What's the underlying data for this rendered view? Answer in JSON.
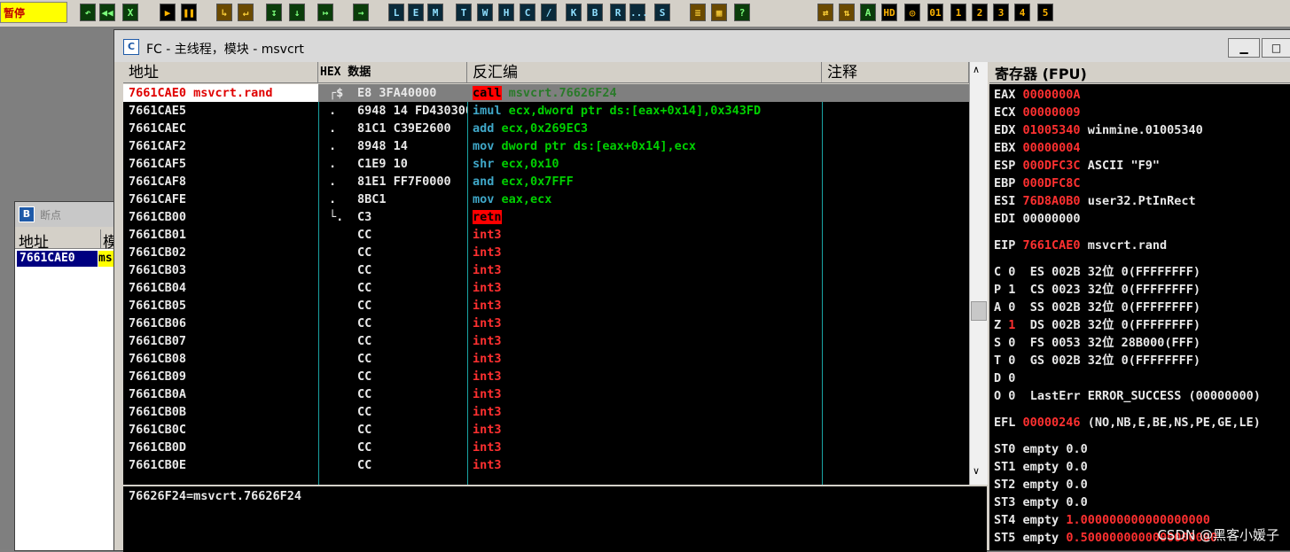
{
  "toolbar": {
    "status": "暂停",
    "buttons": [
      "↶",
      "◀◀",
      "X",
      "▶",
      "❚❚",
      "↳",
      "↵",
      "↧",
      "↓",
      "↦",
      "→",
      "L",
      "E",
      "M",
      "T",
      "W",
      "H",
      "C",
      "/",
      "K",
      "B",
      "R",
      "...",
      "S",
      "≡",
      "▦",
      "?",
      "⇄",
      "⇅",
      "A",
      "HD",
      "◎",
      "01",
      "1",
      "2",
      "3",
      "4",
      "5"
    ]
  },
  "bp_window": {
    "title": "断点",
    "header_addr": "地址",
    "header_module": "模",
    "row_addr": "7661CAE0",
    "row_module": "ms"
  },
  "cpu_window": {
    "title": "FC - 主线程，模块 - msvcrt",
    "headers": {
      "addr": "地址",
      "hex": "HEX 数据",
      "asm": "反汇编",
      "comment": "注释",
      "regs": "寄存器 (FPU)"
    },
    "rows": [
      {
        "addr": "7661CAE0 msvcrt.rand",
        "mark": "┌$",
        "hex": "E8 3FA40000",
        "op": "call",
        "args": "msvcrt.76626F24",
        "op_hl": true,
        "selected": true
      },
      {
        "addr": "7661CAE5",
        "mark": ".",
        "hex": "6948 14 FD430300",
        "op": "imul",
        "args": "ecx,dword ptr ds:[eax+0x14],0x343FD"
      },
      {
        "addr": "7661CAEC",
        "mark": ".",
        "hex": "81C1 C39E2600",
        "op": "add",
        "args": "ecx,0x269EC3"
      },
      {
        "addr": "7661CAF2",
        "mark": ".",
        "hex": "8948 14",
        "op": "mov",
        "args": "dword ptr ds:[eax+0x14],ecx"
      },
      {
        "addr": "7661CAF5",
        "mark": ".",
        "hex": "C1E9 10",
        "op": "shr",
        "args": "ecx,0x10"
      },
      {
        "addr": "7661CAF8",
        "mark": ".",
        "hex": "81E1 FF7F0000",
        "op": "and",
        "args": "ecx,0x7FFF"
      },
      {
        "addr": "7661CAFE",
        "mark": ".",
        "hex": "8BC1",
        "op": "mov",
        "args": "eax,ecx"
      },
      {
        "addr": "7661CB00",
        "mark": "└.",
        "hex": "C3",
        "op": "retn",
        "args": "",
        "op_hl": true
      },
      {
        "addr": "7661CB01",
        "mark": "",
        "hex": "CC",
        "op": "int3",
        "args": ""
      },
      {
        "addr": "7661CB02",
        "mark": "",
        "hex": "CC",
        "op": "int3",
        "args": ""
      },
      {
        "addr": "7661CB03",
        "mark": "",
        "hex": "CC",
        "op": "int3",
        "args": ""
      },
      {
        "addr": "7661CB04",
        "mark": "",
        "hex": "CC",
        "op": "int3",
        "args": ""
      },
      {
        "addr": "7661CB05",
        "mark": "",
        "hex": "CC",
        "op": "int3",
        "args": ""
      },
      {
        "addr": "7661CB06",
        "mark": "",
        "hex": "CC",
        "op": "int3",
        "args": ""
      },
      {
        "addr": "7661CB07",
        "mark": "",
        "hex": "CC",
        "op": "int3",
        "args": ""
      },
      {
        "addr": "7661CB08",
        "mark": "",
        "hex": "CC",
        "op": "int3",
        "args": ""
      },
      {
        "addr": "7661CB09",
        "mark": "",
        "hex": "CC",
        "op": "int3",
        "args": ""
      },
      {
        "addr": "7661CB0A",
        "mark": "",
        "hex": "CC",
        "op": "int3",
        "args": ""
      },
      {
        "addr": "7661CB0B",
        "mark": "",
        "hex": "CC",
        "op": "int3",
        "args": ""
      },
      {
        "addr": "7661CB0C",
        "mark": "",
        "hex": "CC",
        "op": "int3",
        "args": ""
      },
      {
        "addr": "7661CB0D",
        "mark": "",
        "hex": "CC",
        "op": "int3",
        "args": ""
      },
      {
        "addr": "7661CB0E",
        "mark": "",
        "hex": "CC",
        "op": "int3",
        "args": ""
      }
    ],
    "info_text": "76626F24=msvcrt.76626F24",
    "registers": [
      {
        "name": "EAX",
        "value": "0000000A",
        "comment": "",
        "red": true
      },
      {
        "name": "ECX",
        "value": "00000009",
        "comment": "",
        "red": true
      },
      {
        "name": "EDX",
        "value": "01005340",
        "comment": "winmine.01005340",
        "red": true
      },
      {
        "name": "EBX",
        "value": "00000004",
        "comment": "",
        "red": true
      },
      {
        "name": "ESP",
        "value": "000DFC3C",
        "comment": "ASCII \"F9\"",
        "red": true
      },
      {
        "name": "EBP",
        "value": "000DFC8C",
        "comment": "",
        "red": true
      },
      {
        "name": "ESI",
        "value": "76D8A0B0",
        "comment": "user32.PtInRect",
        "red": true
      },
      {
        "name": "EDI",
        "value": "00000000",
        "comment": "",
        "red": false
      }
    ],
    "eip": {
      "name": "EIP",
      "value": "7661CAE0",
      "comment": "msvcrt.rand"
    },
    "flags": [
      {
        "f": "C",
        "v": "0",
        "seg": "ES",
        "sv": "002B",
        "bits": "32位",
        "base": "0(FFFFFFFF)",
        "red": false
      },
      {
        "f": "P",
        "v": "1",
        "seg": "CS",
        "sv": "0023",
        "bits": "32位",
        "base": "0(FFFFFFFF)",
        "red": false
      },
      {
        "f": "A",
        "v": "0",
        "seg": "SS",
        "sv": "002B",
        "bits": "32位",
        "base": "0(FFFFFFFF)",
        "red": false
      },
      {
        "f": "Z",
        "v": "1",
        "seg": "DS",
        "sv": "002B",
        "bits": "32位",
        "base": "0(FFFFFFFF)",
        "red": true
      },
      {
        "f": "S",
        "v": "0",
        "seg": "FS",
        "sv": "0053",
        "bits": "32位",
        "base": "28B000(FFF)",
        "red": false
      },
      {
        "f": "T",
        "v": "0",
        "seg": "GS",
        "sv": "002B",
        "bits": "32位",
        "base": "0(FFFFFFFF)",
        "red": false
      },
      {
        "f": "D",
        "v": "0",
        "seg": "",
        "sv": "",
        "bits": "",
        "base": "",
        "red": false
      },
      {
        "f": "O",
        "v": "0",
        "seg": "LastErr",
        "sv": "ERROR_SUCCESS",
        "bits": "",
        "base": "(00000000)",
        "red": false
      }
    ],
    "efl": {
      "name": "EFL",
      "value": "00000246",
      "comment": "(NO,NB,E,BE,NS,PE,GE,LE)"
    },
    "fpu": [
      {
        "name": "ST0",
        "state": "empty",
        "value": "0.0",
        "red": false
      },
      {
        "name": "ST1",
        "state": "empty",
        "value": "0.0",
        "red": false
      },
      {
        "name": "ST2",
        "state": "empty",
        "value": "0.0",
        "red": false
      },
      {
        "name": "ST3",
        "state": "empty",
        "value": "0.0",
        "red": false
      },
      {
        "name": "ST4",
        "state": "empty",
        "value": "1.000000000000000000",
        "red": true
      },
      {
        "name": "ST5",
        "state": "empty",
        "value": "0.5000000000000000000",
        "red": true
      }
    ]
  },
  "watermark": "CSDN @黑客小媛子",
  "colors": {
    "op_blue": "#3fa7c8",
    "arg_green": "#00d000",
    "red": "#ff3030",
    "hl_red": "#ff0000"
  }
}
